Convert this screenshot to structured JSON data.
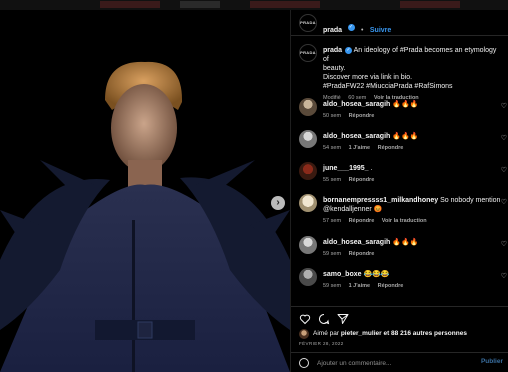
{
  "post": {
    "account": "prada",
    "brand_avatar_text": "PRADA",
    "follow_label": "Suivre",
    "caption_lines": [
      "An ideology of #Prada becomes an etymology of",
      "beauty.",
      "Discover more via link in bio.",
      "#PradaFW22 #MiucciaPrada #RafSimons"
    ],
    "caption_edited": "Modifié",
    "caption_time": "60 sem",
    "caption_translate": "Voir la traduction"
  },
  "comments": [
    {
      "user": "aldo_hosea_saragih",
      "text": "🔥🔥🔥",
      "time": "50 sem",
      "likes": "",
      "reply": "Répondre",
      "translate": ""
    },
    {
      "user": "aldo_hosea_saragih",
      "text": "🔥🔥🔥",
      "time": "54 sem",
      "likes": "1 J'aime",
      "reply": "Répondre",
      "translate": ""
    },
    {
      "user": "june___1995_",
      "text": ".",
      "time": "55 sem",
      "likes": "",
      "reply": "Répondre",
      "translate": ""
    },
    {
      "user": "bornanempressss1_milkandhoney",
      "text": "So nobody mention @kendalljenner 😡",
      "time": "57 sem",
      "likes": "",
      "reply": "Répondre",
      "translate": "Voir la traduction"
    },
    {
      "user": "aldo_hosea_saragih",
      "text": "🔥🔥🔥",
      "time": "59 sem",
      "likes": "",
      "reply": "Répondre",
      "translate": ""
    },
    {
      "user": "samo_boxe",
      "text": "😂😂😂",
      "time": "59 sem",
      "likes": "1 J'aime",
      "reply": "Répondre",
      "translate": ""
    }
  ],
  "liked_by": {
    "prefix": "Aimé par",
    "user": "pieter_mulier",
    "suffix": "et 88 216 autres personnes"
  },
  "date": "FÉVRIER 28, 2022",
  "add_comment": {
    "placeholder": "Ajouter un commentaire...",
    "publish": "Publier"
  },
  "icons": {
    "like": "heart-icon",
    "comment": "comment-icon",
    "share": "share-icon",
    "next": "chevron-right-icon",
    "emoji": "emoji-icon"
  },
  "colors": {
    "accent": "#3897f0",
    "background": "#000000",
    "muted": "#a8a8a8"
  }
}
